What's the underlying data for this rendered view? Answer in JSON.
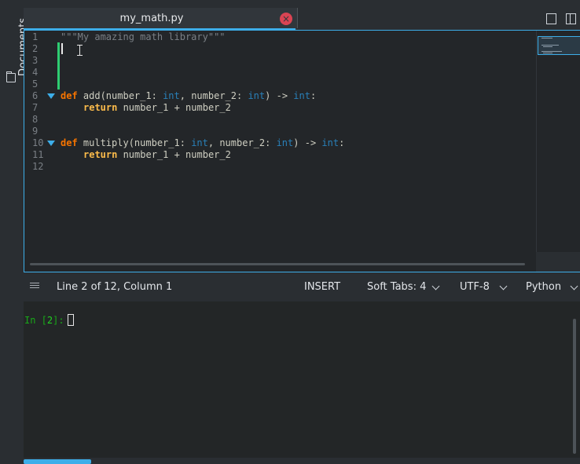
{
  "sidepanel": {
    "documents_label": "Documents"
  },
  "tab": {
    "filename": "my_math.py",
    "close_glyph": "×"
  },
  "gutter": {
    "line_numbers": [
      "1",
      "2",
      "3",
      "4",
      "5",
      "6",
      "7",
      "8",
      "9",
      "10",
      "11",
      "12"
    ]
  },
  "code": {
    "line1": "\"\"\"My amazing math library\"\"\"",
    "line6": {
      "kw": "def",
      "name": " add(number_1",
      "c1": ": ",
      "t1": "int",
      "mid": ", number_2: ",
      "t2": "int",
      "arrow": ") -> ",
      "t3": "int",
      "end": ":"
    },
    "line7": {
      "kw": "return",
      "rest": " number_1 + number_2"
    },
    "line10": {
      "kw": "def",
      "name": " multiply(number_1",
      "c1": ": ",
      "t1": "int",
      "mid": ", number_2: ",
      "t2": "int",
      "arrow": ") -> ",
      "t3": "int",
      "end": ":"
    },
    "line11": {
      "kw": "return",
      "rest": " number_1 + number_2"
    }
  },
  "statusbar": {
    "position": "Line 2 of 12, Column 1",
    "mode": "INSERT",
    "indent": "Soft Tabs: 4",
    "encoding": "UTF-8",
    "language": "Python"
  },
  "console": {
    "prompt_prefix": "In [",
    "prompt_number": "2",
    "prompt_suffix": "]: "
  },
  "colors": {
    "accent": "#3daee9",
    "modified": "#2ecc71",
    "close": "#da4453",
    "prompt": "#18a818"
  }
}
